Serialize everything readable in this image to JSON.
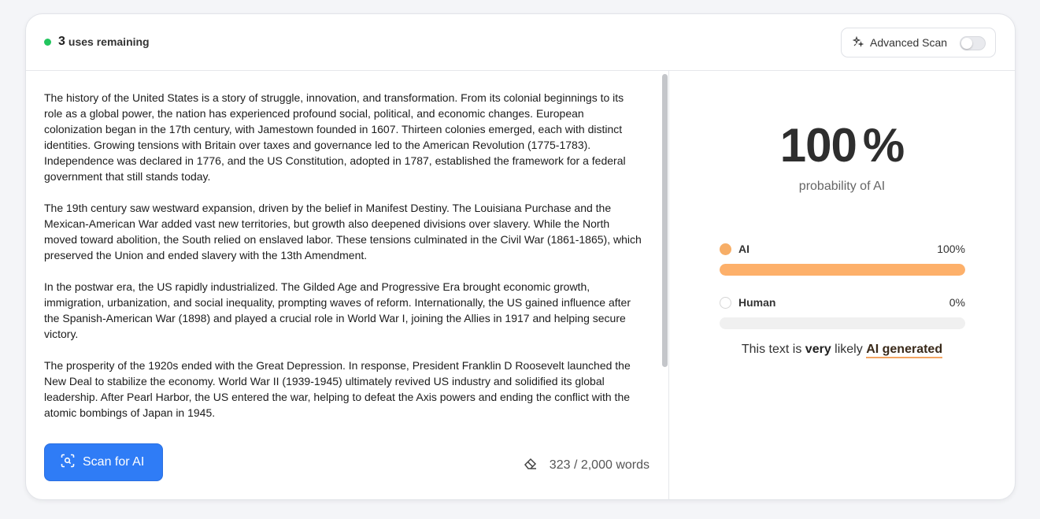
{
  "header": {
    "uses_count": "3",
    "uses_label": "uses remaining",
    "advanced_scan_label": "Advanced Scan",
    "advanced_scan_enabled": false
  },
  "editor": {
    "paragraphs": [
      "The history of the United States is a story of struggle, innovation, and transformation. From its colonial beginnings to its role as a global power, the nation has experienced profound social, political, and economic changes. European colonization began in the 17th century, with Jamestown founded in 1607. Thirteen colonies emerged, each with distinct identities. Growing tensions with Britain over taxes and governance led to the American Revolution (1775-1783). Independence was declared in 1776, and the US Constitution, adopted in 1787, established the framework for a federal government that still stands today.",
      "The 19th century saw westward expansion, driven by the belief in Manifest Destiny. The Louisiana Purchase and the Mexican-American War added vast new territories, but growth also deepened divisions over slavery. While the North moved toward abolition, the South relied on enslaved labor. These tensions culminated in the Civil War (1861-1865), which preserved the Union and ended slavery with the 13th Amendment.",
      "In the postwar era, the US rapidly industrialized. The Gilded Age and Progressive Era brought economic growth, immigration, urbanization, and social inequality, prompting waves of reform. Internationally, the US gained influence after the Spanish-American War (1898) and played a crucial role in World War I, joining the Allies in 1917 and helping secure victory.",
      "The prosperity of the 1920s ended with the Great Depression. In response, President Franklin D Roosevelt launched the New Deal to stabilize the economy. World War II (1939-1945) ultimately revived US industry and solidified its global leadership. After Pearl Harbor, the US entered the war, helping to defeat the Axis powers and ending the conflict with the atomic bombings of Japan in 1945."
    ],
    "scan_button_label": "Scan for AI",
    "word_count": "323 / 2,000 words"
  },
  "result": {
    "score": "100",
    "score_unit": "%",
    "score_label": "probability of AI",
    "breakdown": [
      {
        "label": "AI",
        "value_text": "100%",
        "fraction": 1.0,
        "color": "#fdb06a",
        "circle_color": "#f7ae67"
      },
      {
        "label": "Human",
        "value_text": "0%",
        "fraction": 0.0,
        "color": "#d9d9d9",
        "circle_color": "#ffffff"
      }
    ],
    "verdict_prefix": "This text is",
    "verdict_strength": "very",
    "verdict_middle": "likely",
    "verdict_label": "AI generated"
  },
  "colors": {
    "accent_blue": "#2f7cf6",
    "status_green": "#22c55e",
    "ai_orange": "#fdb06a"
  }
}
